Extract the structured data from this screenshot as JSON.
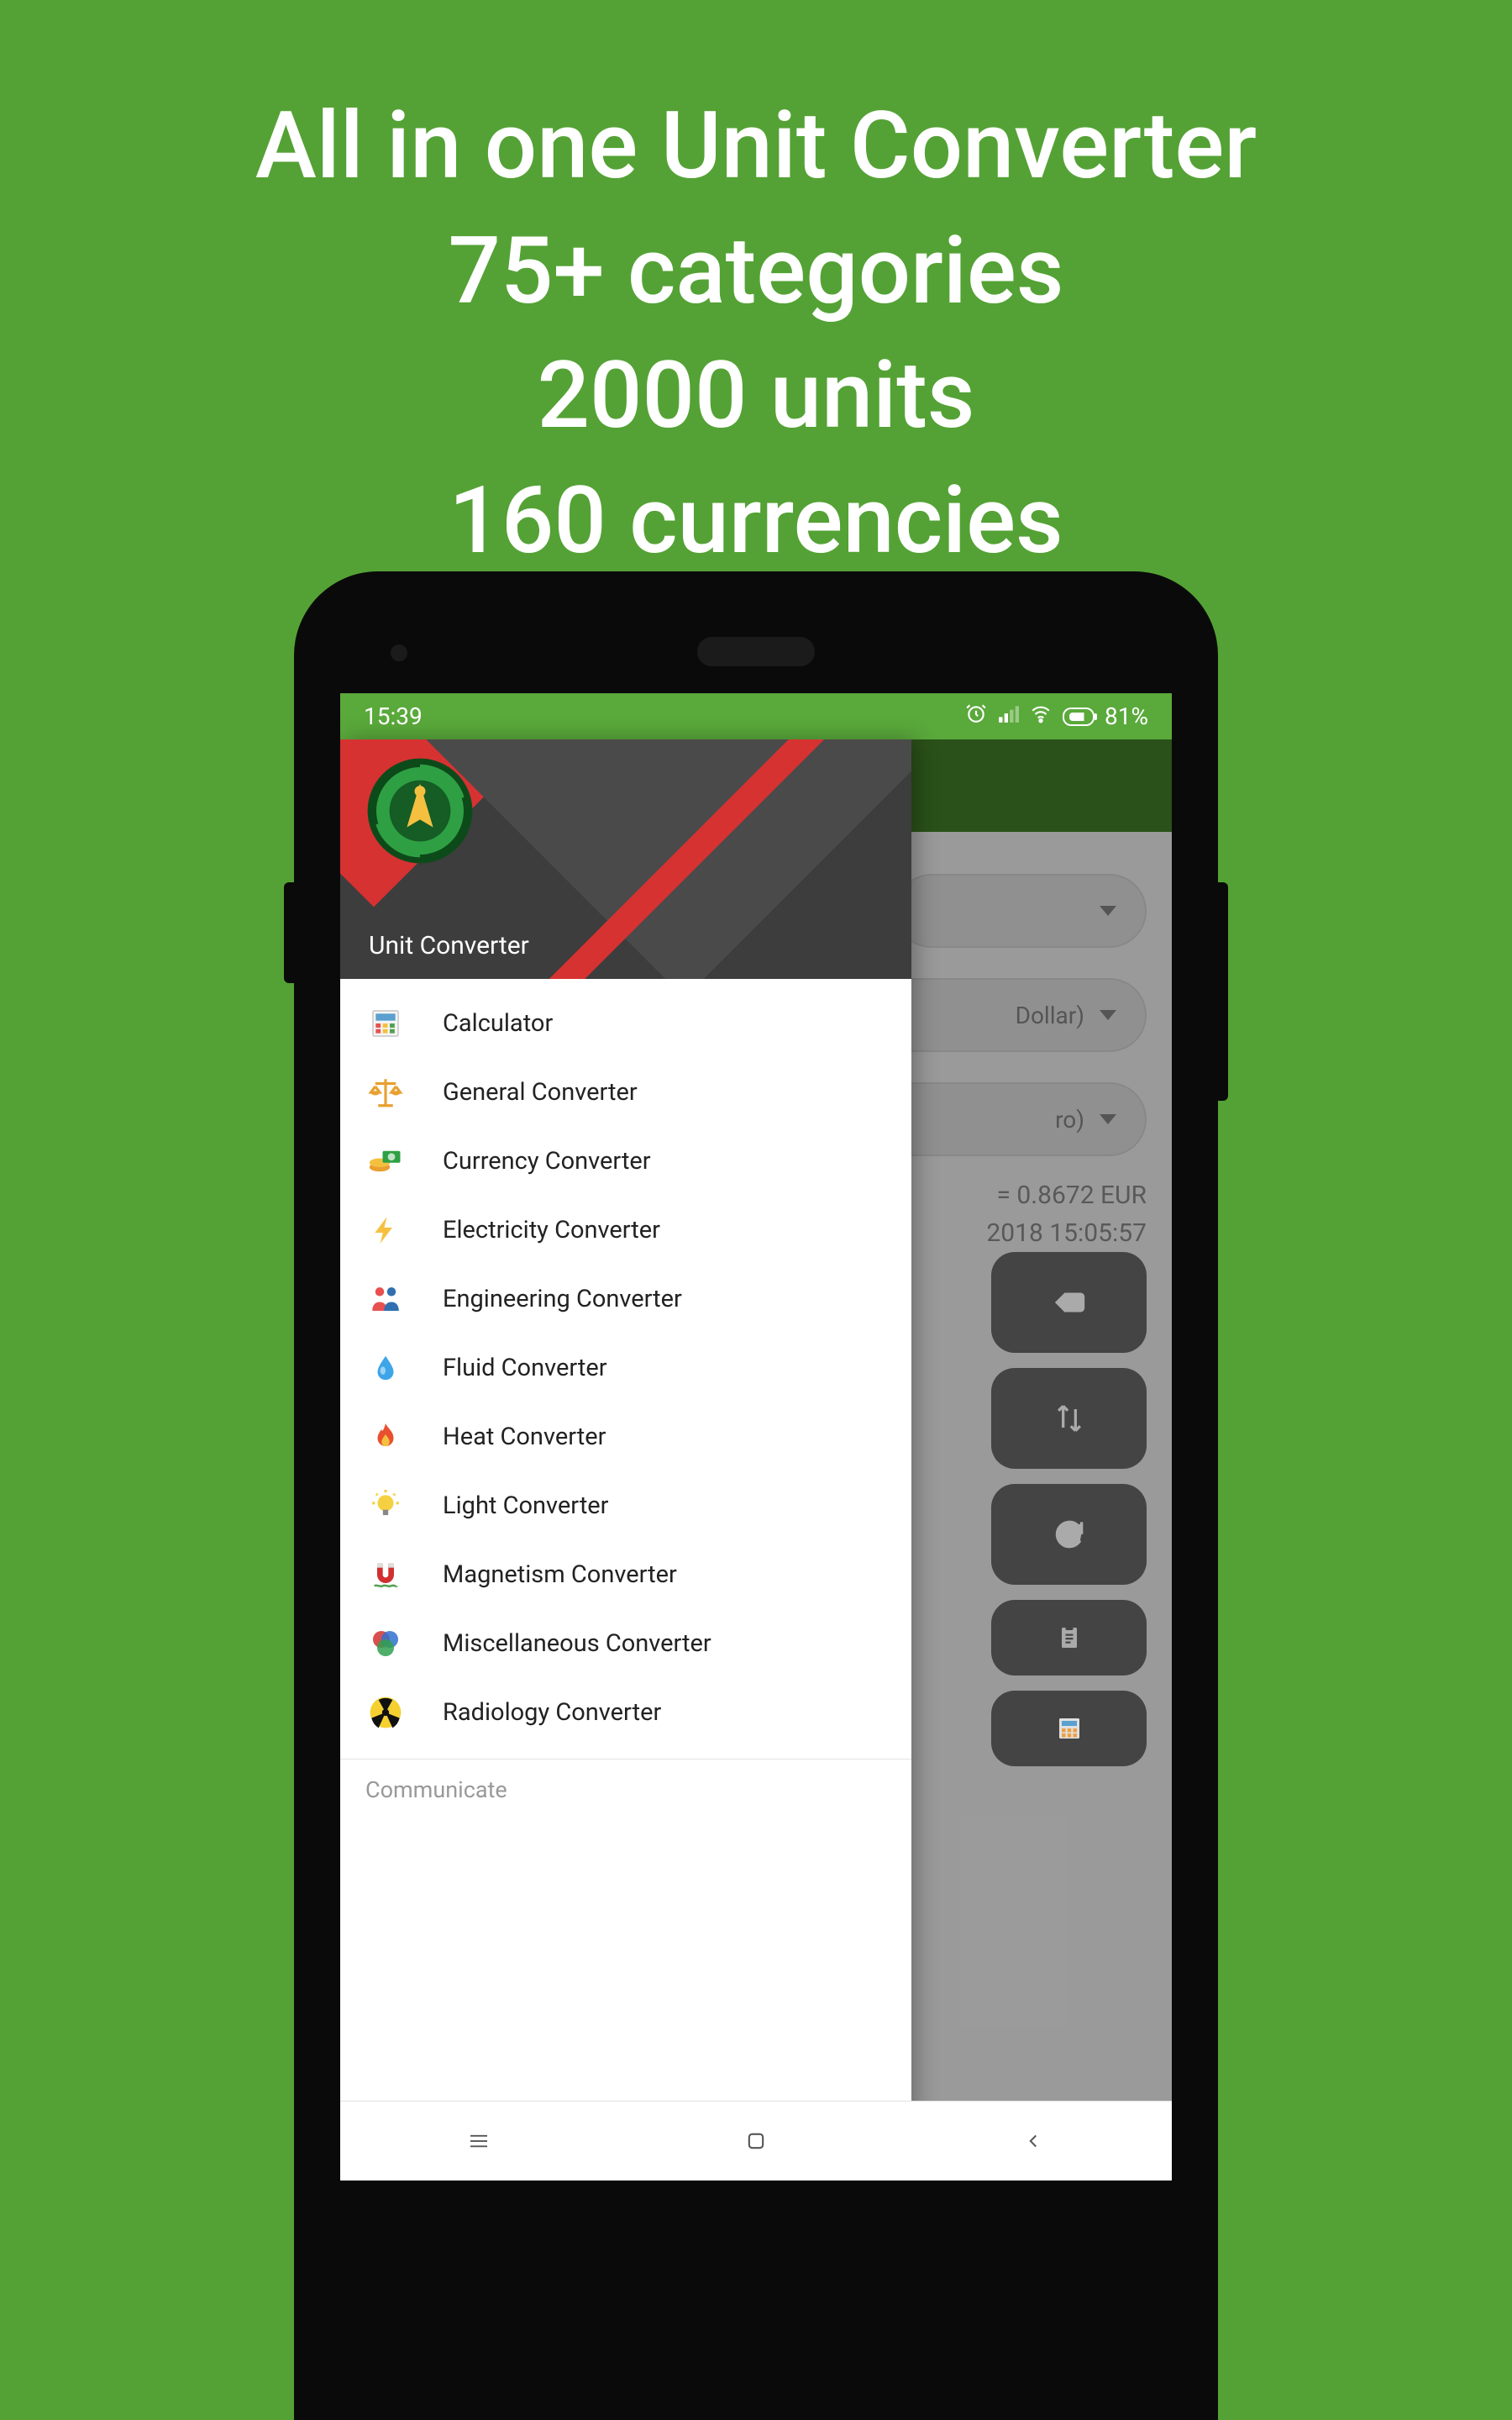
{
  "promo": {
    "line1": "All in one Unit Converter",
    "line2": "75+ categories",
    "line3": "2000 units",
    "line4": "160 currencies"
  },
  "statusbar": {
    "time": "15:39",
    "battery": "81%"
  },
  "drawer": {
    "title": "Unit Converter",
    "items": [
      {
        "label": "Calculator",
        "icon": "calculator"
      },
      {
        "label": "General Converter",
        "icon": "scale"
      },
      {
        "label": "Currency Converter",
        "icon": "money"
      },
      {
        "label": "Electricity Converter",
        "icon": "bolt"
      },
      {
        "label": "Engineering Converter",
        "icon": "engineers"
      },
      {
        "label": "Fluid Converter",
        "icon": "droplet"
      },
      {
        "label": "Heat Converter",
        "icon": "fire"
      },
      {
        "label": "Light Converter",
        "icon": "bulb"
      },
      {
        "label": "Magnetism Converter",
        "icon": "magnet"
      },
      {
        "label": "Miscellaneous Converter",
        "icon": "circles"
      },
      {
        "label": "Radiology Converter",
        "icon": "radiation"
      }
    ],
    "section": "Communicate"
  },
  "main": {
    "from_currency": "Dollar)",
    "to_currency": "ro)",
    "rate_line1": "= 0.8672 EUR",
    "rate_line2": "2018 15:05:57"
  }
}
